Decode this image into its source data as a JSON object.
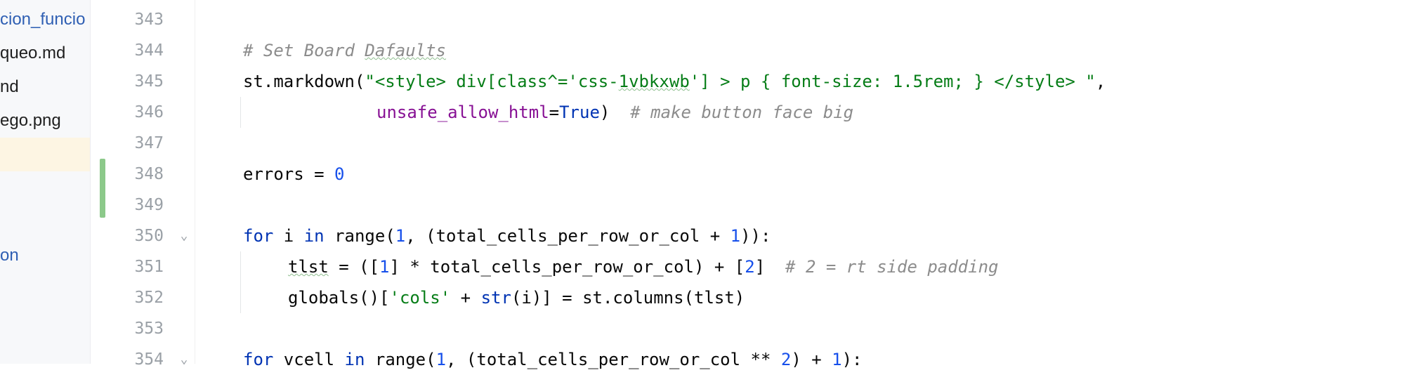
{
  "sidebar": {
    "files": [
      {
        "label": "cion_funcio",
        "color": "blue"
      },
      {
        "label": "queo.md",
        "color": "default"
      },
      {
        "label": "nd",
        "color": "default"
      },
      {
        "label": "ego.png",
        "color": "default"
      },
      {
        "label": "",
        "color": "selected"
      },
      {
        "label": "on",
        "color": "blue"
      }
    ]
  },
  "editor": {
    "line_numbers": [
      "343",
      "344",
      "345",
      "346",
      "347",
      "348",
      "349",
      "350",
      "351",
      "352",
      "353",
      "354"
    ],
    "lines": {
      "l344": {
        "comment": "# Set Board ",
        "comment_typo": "Dafaults"
      },
      "l345": {
        "a": "st.markdown(",
        "s1": "\"<style> div[class^='css-",
        "s1_typo": "1vbkxwb",
        "s2": "'] > p { font-size: 1.5rem; } </style> \"",
        "b": ","
      },
      "l346": {
        "kwarg": "unsafe_allow_html",
        "eq": "=",
        "kw": "True",
        "close": ")",
        "comment": "# make button face big"
      },
      "l348": {
        "a": "errors = ",
        "num": "0"
      },
      "l350": {
        "kw1": "for",
        "a": " i ",
        "kw2": "in",
        "b": " range(",
        "n1": "1",
        "c": ", (total_cells_per_row_or_col + ",
        "n2": "1",
        "d": ")):"
      },
      "l351": {
        "typo": "tlst",
        "a": " = ([",
        "n1": "1",
        "b": "] * total_cells_per_row_or_col) + [",
        "n2": "2",
        "c": "]  ",
        "comment": "# 2 = rt side padding"
      },
      "l352": {
        "a": "globals()[",
        "s": "'cols'",
        "b": " + ",
        "kw": "str",
        "c": "(i)] = st.columns(tlst)"
      },
      "l354": {
        "kw1": "for",
        "a": " vcell ",
        "kw2": "in",
        "b": " range(",
        "n1": "1",
        "c": ", (total_cells_per_row_or_col ** ",
        "n2": "2",
        "d": ") + ",
        "n3": "1",
        "e": "):"
      }
    },
    "fold_icons": [
      "chevron-down",
      "chevron-down"
    ]
  },
  "colors": {
    "comment": "#8c8c8c",
    "string": "#067d17",
    "number": "#1750eb",
    "keyword": "#0033b3",
    "kwarg": "#871094",
    "change_marker": "#8cc98a",
    "selected_row": "#fdf5e3"
  }
}
